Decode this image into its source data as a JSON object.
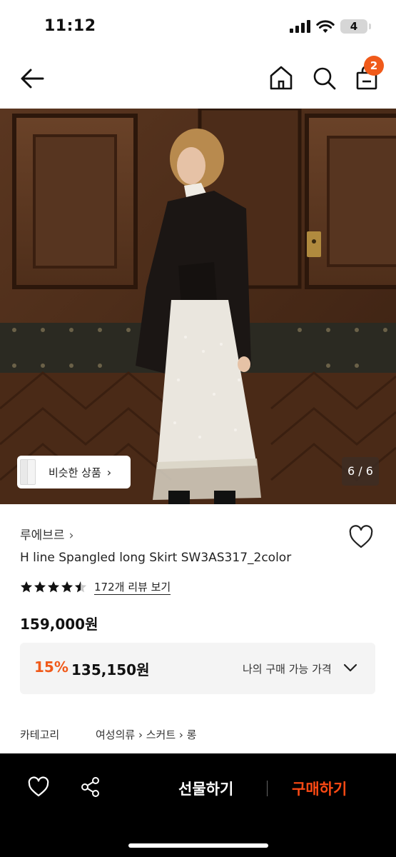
{
  "status_bar": {
    "time": "11:12",
    "battery": "4"
  },
  "header": {
    "cart_count": "2",
    "icons": [
      "back-arrow-icon",
      "home-icon",
      "search-icon",
      "shopping-bag-icon"
    ]
  },
  "hero": {
    "similar_label": "비슷한 상품",
    "similar_chevron": "›",
    "photo_counter": "6 / 6"
  },
  "product": {
    "brand": "루에브르",
    "brand_chevron": "›",
    "title": "H line Spangled long Skirt SW3AS317_2color",
    "rating": 4.5,
    "review_link": "172개 리뷰 보기",
    "original_price": "159,000원",
    "discount": "15%",
    "sale_price": "135,150원",
    "my_price_label": "나의 구매 가능 가격",
    "category_label": "카테고리",
    "category_path": "여성의류 › 스커트 › 롱"
  },
  "bottom_bar": {
    "gift_label": "선물하기",
    "buy_label": "구매하기"
  },
  "colors": {
    "accent": "#f05a1a",
    "buy": "#ff4a14",
    "bar_bg": "#000000"
  }
}
